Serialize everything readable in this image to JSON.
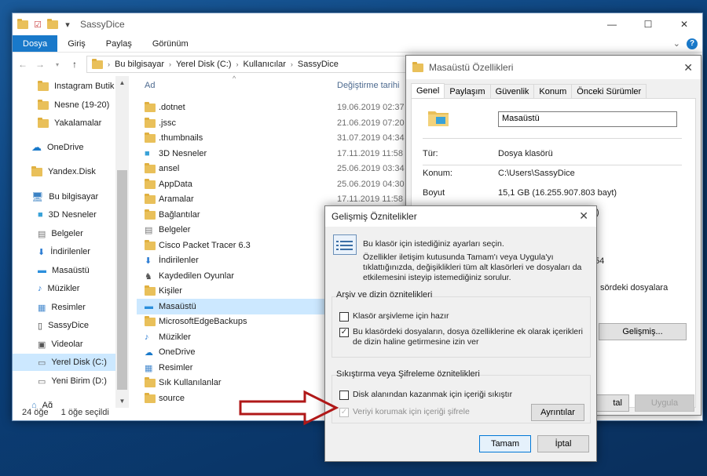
{
  "explorer": {
    "title": "SassyDice",
    "ribbon_tabs": [
      "Dosya",
      "Giriş",
      "Paylaş",
      "Görünüm"
    ],
    "breadcrumbs": [
      "Bu bilgisayar",
      "Yerel Disk (C:)",
      "Kullanıcılar",
      "SassyDice"
    ],
    "nav_items": [
      {
        "label": "Instagram Butik",
        "icon": "folder-icon"
      },
      {
        "label": "Nesne (19-20)",
        "icon": "folder-icon"
      },
      {
        "label": "Yakalamalar",
        "icon": "folder-icon"
      },
      {
        "label": "OneDrive",
        "icon": "cloud-icon"
      },
      {
        "label": "Yandex.Disk",
        "icon": "folder-icon"
      },
      {
        "label": "Bu bilgisayar",
        "icon": "computer-icon"
      },
      {
        "label": "3D Nesneler",
        "icon": "cube-icon"
      },
      {
        "label": "Belgeler",
        "icon": "document-icon"
      },
      {
        "label": "İndirilenler",
        "icon": "download-icon"
      },
      {
        "label": "Masaüstü",
        "icon": "desktop-icon"
      },
      {
        "label": "Müzikler",
        "icon": "music-icon"
      },
      {
        "label": "Resimler",
        "icon": "pictures-icon"
      },
      {
        "label": "SassyDice",
        "icon": "phone-icon"
      },
      {
        "label": "Videolar",
        "icon": "video-icon"
      },
      {
        "label": "Yerel Disk (C:)",
        "icon": "drive-icon"
      },
      {
        "label": "Yeni Birim (D:)",
        "icon": "drive-icon"
      },
      {
        "label": "Ağ",
        "icon": "network-icon"
      }
    ],
    "columns": {
      "name": "Ad",
      "date": "Değiştirme tarihi"
    },
    "files": [
      {
        "name": ".dotnet",
        "date": "19.06.2019 02:37",
        "icon": "folder-icon"
      },
      {
        "name": ".jssc",
        "date": "21.06.2019 07:20",
        "icon": "folder-icon"
      },
      {
        "name": ".thumbnails",
        "date": "31.07.2019 04:34",
        "icon": "folder-icon"
      },
      {
        "name": "3D Nesneler",
        "date": "17.11.2019 11:58",
        "icon": "cube-icon"
      },
      {
        "name": "ansel",
        "date": "25.06.2019 03:34",
        "icon": "folder-icon"
      },
      {
        "name": "AppData",
        "date": "25.06.2019 04:30",
        "icon": "folder-icon"
      },
      {
        "name": "Aramalar",
        "date": "17.11.2019 11:58",
        "icon": "search-folder-icon"
      },
      {
        "name": "Bağlantılar",
        "date": "",
        "icon": "links-icon"
      },
      {
        "name": "Belgeler",
        "date": "",
        "icon": "document-icon"
      },
      {
        "name": "Cisco Packet Tracer 6.3",
        "date": "",
        "icon": "folder-icon"
      },
      {
        "name": "İndirilenler",
        "date": "",
        "icon": "download-icon"
      },
      {
        "name": "Kaydedilen Oyunlar",
        "date": "",
        "icon": "games-icon"
      },
      {
        "name": "Kişiler",
        "date": "",
        "icon": "contacts-icon"
      },
      {
        "name": "Masaüstü",
        "date": "",
        "icon": "desktop-icon"
      },
      {
        "name": "MicrosoftEdgeBackups",
        "date": "",
        "icon": "folder-icon"
      },
      {
        "name": "Müzikler",
        "date": "",
        "icon": "music-icon"
      },
      {
        "name": "OneDrive",
        "date": "",
        "icon": "cloud-icon"
      },
      {
        "name": "Resimler",
        "date": "",
        "icon": "pictures-icon"
      },
      {
        "name": "Sık Kullanılanlar",
        "date": "",
        "icon": "favorites-icon"
      },
      {
        "name": "source",
        "date": "",
        "icon": "folder-icon"
      }
    ],
    "status": {
      "count": "24 öğe",
      "selected": "1 öğe seçildi"
    }
  },
  "properties": {
    "title": "Masaüstü Özellikleri",
    "tabs": [
      "Genel",
      "Paylaşım",
      "Güvenlik",
      "Konum",
      "Önceki Sürümler"
    ],
    "name_value": "Masaüstü",
    "type_label": "Tür:",
    "type_value": "Dosya klasörü",
    "location_label": "Konum:",
    "location_value": "C:\\Users\\SassyDice",
    "size_label": "Boyut",
    "size_value": "15,1 GB (16.255.907.803 bayt)",
    "partial_1": "t)",
    "partial_2": "54",
    "partial_3": "sördeki dosyalara",
    "advanced_button": "Gelişmiş...",
    "footer_buttons": {
      "cancel_partial": "tal",
      "apply": "Uygula"
    }
  },
  "advanced": {
    "title": "Gelişmiş Öznitelikler",
    "intro_1": "Bu klasör için istediğiniz ayarları seçin.",
    "intro_2": "Özellikler iletişim kutusunda Tamam'ı veya Uygula'yı tıklattığınızda, değişiklikleri tüm alt klasörleri ve dosyaları da etkilemesini isteyip istemediğiniz sorulur.",
    "archive_group": "Arşiv ve dizin öznitelikleri",
    "archive_check": "Klasör arşivleme için hazır",
    "index_check": "Bu klasördeki dosyaların, dosya özelliklerine ek olarak içerikleri de dizin haline getirmesine izin ver",
    "compress_group": "Sıkıştırma veya Şifreleme öznitelikleri",
    "compress_check": "Disk alanından kazanmak için içeriği sıkıştır",
    "encrypt_check": "Veriyi korumak için içeriği şifrele",
    "details_button": "Ayrıntılar",
    "ok_button": "Tamam",
    "cancel_button": "İptal"
  },
  "colors": {
    "accent": "#1979ca",
    "selection": "#cce8ff",
    "arrow": "#b01818"
  }
}
